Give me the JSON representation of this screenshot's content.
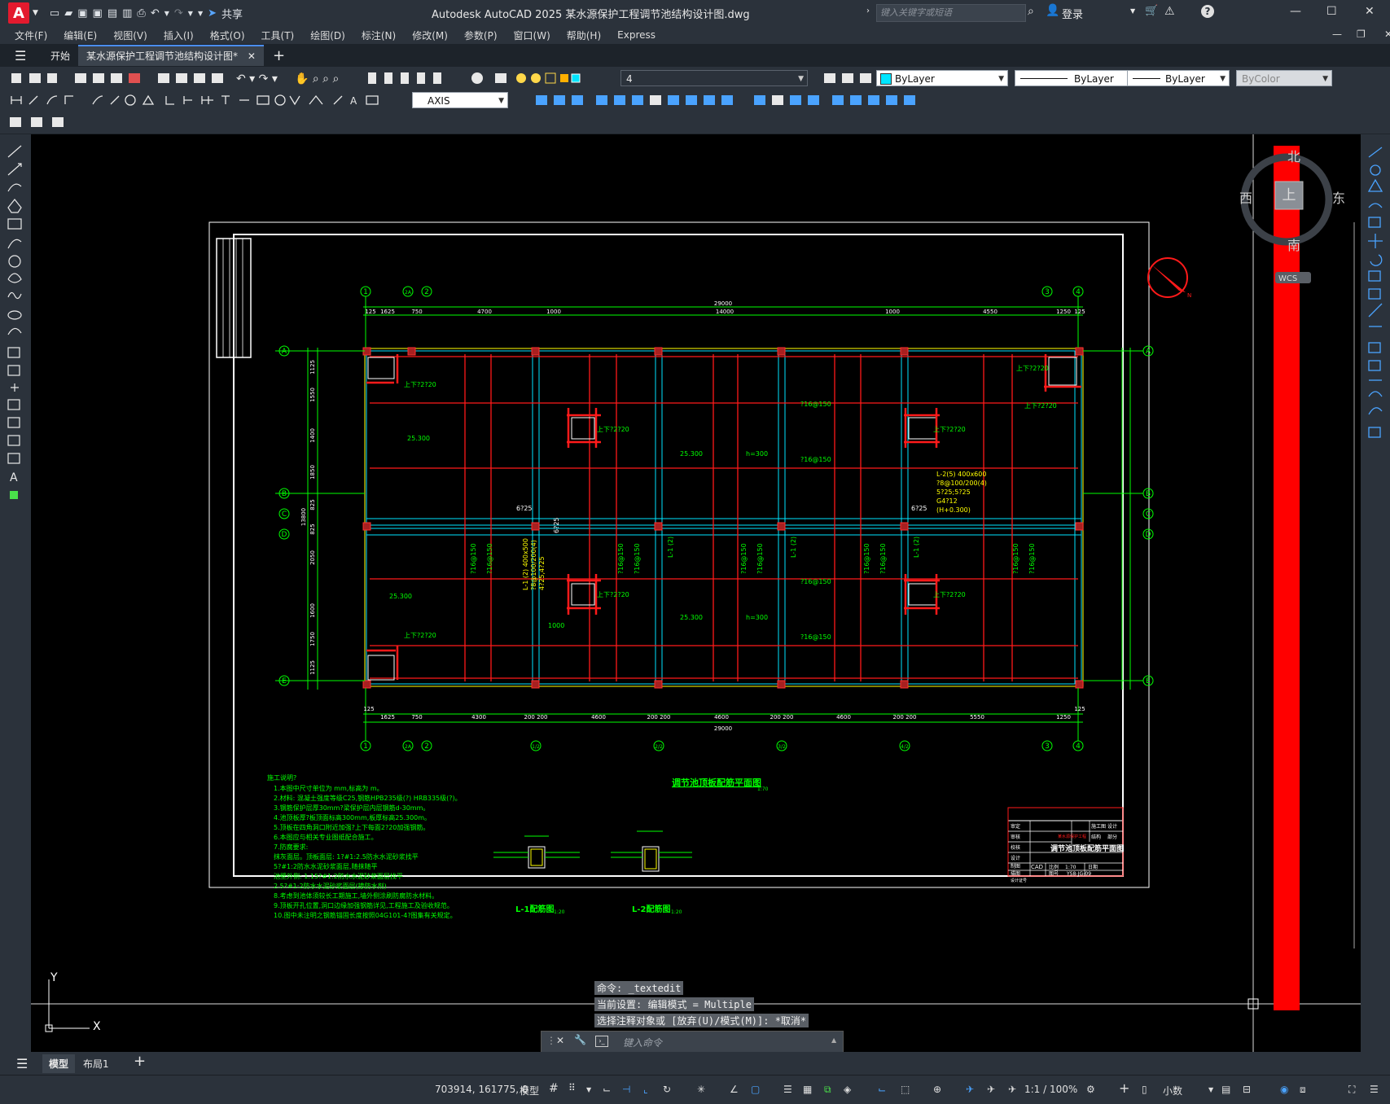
{
  "app": {
    "logo": "A",
    "title": "Autodesk AutoCAD 2025    某水源保护工程调节池结构设计图.dwg",
    "share": "共享",
    "search_placeholder": "键入关键字或短语",
    "login": "登录"
  },
  "menu": [
    "文件(F)",
    "编辑(E)",
    "视图(V)",
    "插入(I)",
    "格式(O)",
    "工具(T)",
    "绘图(D)",
    "标注(N)",
    "修改(M)",
    "参数(P)",
    "窗口(W)",
    "帮助(H)",
    "Express"
  ],
  "tabs": {
    "start": "开始",
    "active": "某水源保护工程调节池结构设计图*",
    "add": "+"
  },
  "toolbar": {
    "layer_value": "4",
    "color_value": "ByLayer",
    "linetype_value": "ByLayer",
    "lineweight_value": "ByLayer",
    "plotstyle_value": "ByColor",
    "dimstyle_value": "AXIS"
  },
  "viewcube": {
    "north": "北",
    "south": "南",
    "east": "东",
    "west": "西",
    "top": "上",
    "wcs": "WCS"
  },
  "ucs": {
    "x": "X",
    "y": "Y"
  },
  "drawing": {
    "plan_title": "调节池顶板配筋平面图",
    "plan_scale": "1:70",
    "section1_title": "L-1配筋图",
    "section2_title": "L-2配筋图",
    "section_scale": "1:20",
    "notes_title": "施工说明?",
    "notes": [
      "1.本图中尺寸单位为 mm,标高为 m。",
      "2.材料: 混凝土强度等级C25,钢筋HPB235级(?) HRB335级(?)。",
      "3.钢筋保护层厚30mm?梁保护层内层钢筋d-30mm。",
      "4.池顶板厚?板顶面标高300mm,板厚标高25.300m。",
      "5.顶板在四角洞口附近加强?上下每面2?20加强钢筋。",
      "6.本图应与相关专业图纸配合施工。",
      "7.防腐要求:",
      "   抹灰面层。顶板面层: 1?#1:2.5防水水泥砂浆找平",
      "        5?#1:2防水水泥砂浆面层,随抹随平",
      "   池壁外侧: 1.15?#1:2防水水泥砂浆面层找平",
      "        2.5?#1:2防水水泥砂浆面层(掺防水剂)",
      "8.考虑到池体须较长工期施工,墙外侧涂刷防腐防水材料。",
      "9.顶板开孔位置,洞口边缘加强钢筋详见,工程施工及验收规范。",
      "10.图中未注明之钢筋锚固长度按照04G101-4?图集有关规定。"
    ],
    "grid_top": [
      "1",
      "2A",
      "2",
      "1/2",
      "2/2",
      "3/2",
      "4/2",
      "3",
      "4"
    ],
    "grid_bottom": [
      "1",
      "2A",
      "2",
      "1/2",
      "2/2",
      "3/2",
      "4/2",
      "3",
      "4"
    ],
    "grid_rows": [
      "A",
      "B",
      "C",
      "D",
      "E"
    ],
    "dim_top_total": "29000",
    "dim_top": [
      "125",
      "1625",
      "750",
      "4700",
      "1000",
      "14000",
      "1000",
      "4550",
      "1250",
      "125"
    ],
    "dim_bottom_total": "29000",
    "dim_bottom": [
      "125",
      "1625",
      "750",
      "4300",
      "200 200",
      "4600",
      "200 200",
      "4600",
      "200 200",
      "4600",
      "200 200",
      "5550",
      "1250",
      "125"
    ],
    "dim_left_total": "13800",
    "dim_left": [
      "125",
      "1125",
      "1550",
      "1400",
      "1850",
      "825",
      "825",
      "2050",
      "1600",
      "1750",
      "1125",
      "125"
    ],
    "labels": {
      "rebar_corner": "上下?2?20",
      "rebar_h": "?16@150",
      "rebar_v": "?16@150",
      "elev": "25.300",
      "thick": "h=300",
      "beam_6": "6?25",
      "beam_l1": "L-1 (2)",
      "beam_l1_detail": "L-1 (2) 400x500",
      "beam_l1_stirrup": "?8@100/200(4)",
      "beam_l1_bars": "4?25,4?25",
      "beam_l2": "L-2(5) 400x600",
      "beam_l2_stirrup": "?8@100/200(4)",
      "beam_l2_bars": "5?25;5?25",
      "beam_l2_extra": "G4?12",
      "beam_l2_elev": "(H+0.300)",
      "w1000": "1000"
    },
    "titleblock": {
      "rows": [
        "审定",
        "审核",
        "校核",
        "设计",
        "制图",
        "描图",
        "设计证号"
      ],
      "company": "某水源保护工程",
      "stage1": "施工图",
      "stage2": "结构",
      "design": "设计",
      "part": "部分",
      "title": "调节池顶板配筋平面图",
      "scale_label": "比例",
      "scale": "1:70",
      "date_label": "日期",
      "drawno_label": "图号",
      "drawno": "YS8-JG-09",
      "logo": "CAD"
    }
  },
  "command": {
    "history": [
      "命令: _textedit",
      "当前设置: 编辑模式 = Multiple",
      "选择注释对象或 [放弃(U)/模式(M)]: *取消*"
    ],
    "placeholder": "键入命令"
  },
  "layouts": {
    "model": "模型",
    "layout1": "布局1",
    "add": "+"
  },
  "status": {
    "coords": "703914, 161775, 0",
    "model": "模型",
    "scale": "1:1 / 100%",
    "units": "小数"
  }
}
